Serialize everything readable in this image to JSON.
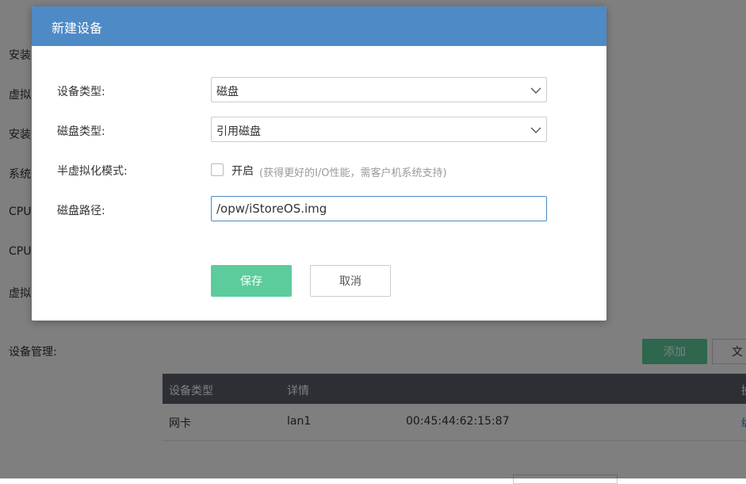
{
  "background": {
    "labels": [
      "安装",
      "虚拟",
      "安装",
      "系统",
      "CPU",
      "CPU",
      "虚拟"
    ],
    "section_title": "设备管理:",
    "add_button": "添加",
    "second_button": "文",
    "table": {
      "headers": [
        "设备类型",
        "详情",
        "操"
      ],
      "rows": [
        {
          "type": "网卡",
          "detail": "lan1",
          "mac": "00:45:44:62:15:87",
          "action": "编"
        }
      ]
    }
  },
  "modal": {
    "title": "新建设备",
    "device_type_label": "设备类型:",
    "device_type_value": "磁盘",
    "disk_type_label": "磁盘类型:",
    "disk_type_value": "引用磁盘",
    "paravirt_label": "半虚拟化模式:",
    "paravirt_option": "开启",
    "paravirt_hint": "(获得更好的I/O性能，需客户机系统支持)",
    "disk_path_label": "磁盘路径:",
    "disk_path_value": "/opw/iStoreOS.img",
    "save_label": "保存",
    "cancel_label": "取消"
  },
  "colors": {
    "header": "#4e8ac5",
    "primary": "#5ccc9c",
    "table_header": "#5a5f6b"
  }
}
